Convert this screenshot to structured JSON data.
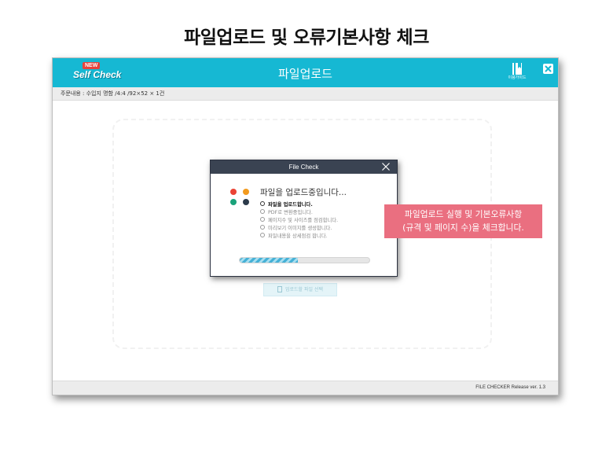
{
  "page": {
    "title": "파일업로드 및 오류기본사항 체크"
  },
  "app": {
    "logo": {
      "badge": "NEW",
      "text": "Self Check"
    },
    "window_title": "파일업로드",
    "guide_label": "이용가이드",
    "order_info": "주문내용 : 수입지 명함 /4:4 /92×52 × 1건",
    "select_file_label": "업로드할 파일 선택",
    "release": "FILE CHECKER Release ver. 1.3",
    "colors": {
      "titlebar": "#16b8d3",
      "dialog_titlebar": "#3a4352",
      "callout": "#ea6f80"
    }
  },
  "dialog": {
    "title": "File Check",
    "heading": "파일을 업로드중입니다...",
    "status_dots": [
      "#ea4335",
      "#f29a1e",
      "#1aa27a",
      "#2b3a4a"
    ],
    "steps": [
      {
        "label": "파일을 업로드합니다.",
        "active": true
      },
      {
        "label": "PDF로 변환중입니다.",
        "active": false
      },
      {
        "label": "페이지수 및 사이즈를 점검합니다.",
        "active": false
      },
      {
        "label": "미리보기 이미지를 생성합니다.",
        "active": false
      },
      {
        "label": "파일내용을 상세점검 합니다.",
        "active": false
      }
    ],
    "progress": 0.45
  },
  "callout": {
    "line1": "파일업로드 실행 및 기본오류사항",
    "line2": "(규격 및 페이지 수)을 체크합니다."
  }
}
